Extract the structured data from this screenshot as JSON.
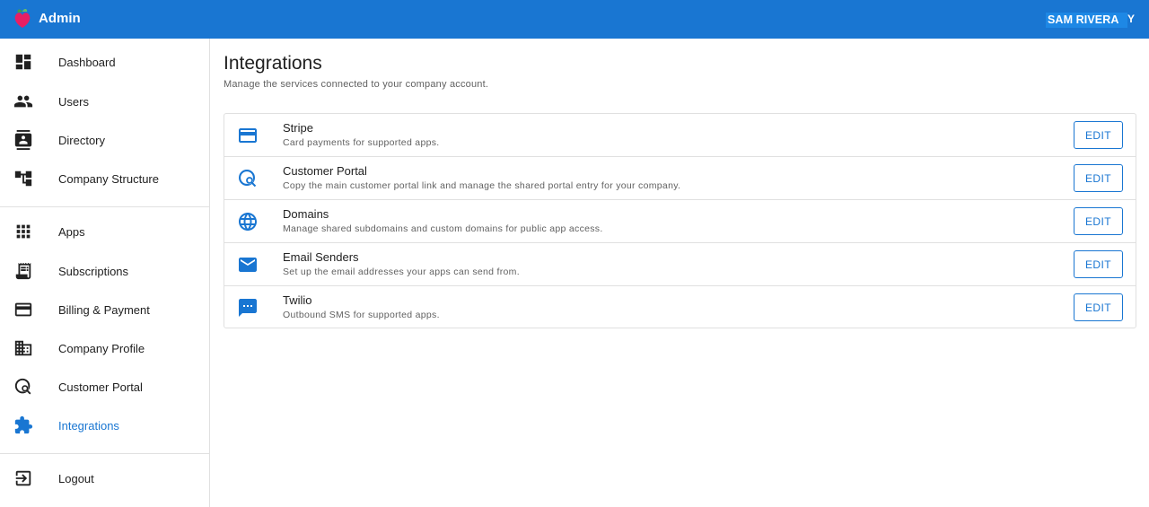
{
  "header": {
    "title": "Admin",
    "user_name": "SAM RIVERA",
    "user_name_overflow": "Y",
    "colors": {
      "bar": "#1976d2",
      "chip": "#1e88e5"
    }
  },
  "sidebar": {
    "items": [
      {
        "label": "Dashboard",
        "icon": "dashboard-icon"
      },
      {
        "label": "Users",
        "icon": "people-icon"
      },
      {
        "label": "Directory",
        "icon": "contacts-icon"
      },
      {
        "label": "Company Structure",
        "icon": "hierarchy-icon"
      },
      {
        "label": "Apps",
        "icon": "apps-grid-icon"
      },
      {
        "label": "Subscriptions",
        "icon": "receipt-icon"
      },
      {
        "label": "Billing & Payment",
        "icon": "credit-card-icon"
      },
      {
        "label": "Company Profile",
        "icon": "building-icon"
      },
      {
        "label": "Customer Portal",
        "icon": "portal-search-icon"
      },
      {
        "label": "Integrations",
        "icon": "puzzle-icon",
        "active": true
      },
      {
        "label": "Logout",
        "icon": "logout-icon"
      }
    ]
  },
  "main": {
    "title": "Integrations",
    "subtitle": "Manage the services connected to your company account.",
    "integrations": [
      {
        "name": "Stripe",
        "description": "Card payments for supported apps.",
        "icon": "credit-card-icon",
        "action": "EDIT"
      },
      {
        "name": "Customer Portal",
        "description": "Copy the main customer portal link and manage the shared portal entry for your company.",
        "icon": "portal-search-icon",
        "action": "EDIT"
      },
      {
        "name": "Domains",
        "description": "Manage shared subdomains and custom domains for public app access.",
        "icon": "globe-icon",
        "action": "EDIT"
      },
      {
        "name": "Email Senders",
        "description": "Set up the email addresses your apps can send from.",
        "icon": "mail-icon",
        "action": "EDIT"
      },
      {
        "name": "Twilio",
        "description": "Outbound SMS for supported apps.",
        "icon": "sms-icon",
        "action": "EDIT"
      }
    ]
  }
}
